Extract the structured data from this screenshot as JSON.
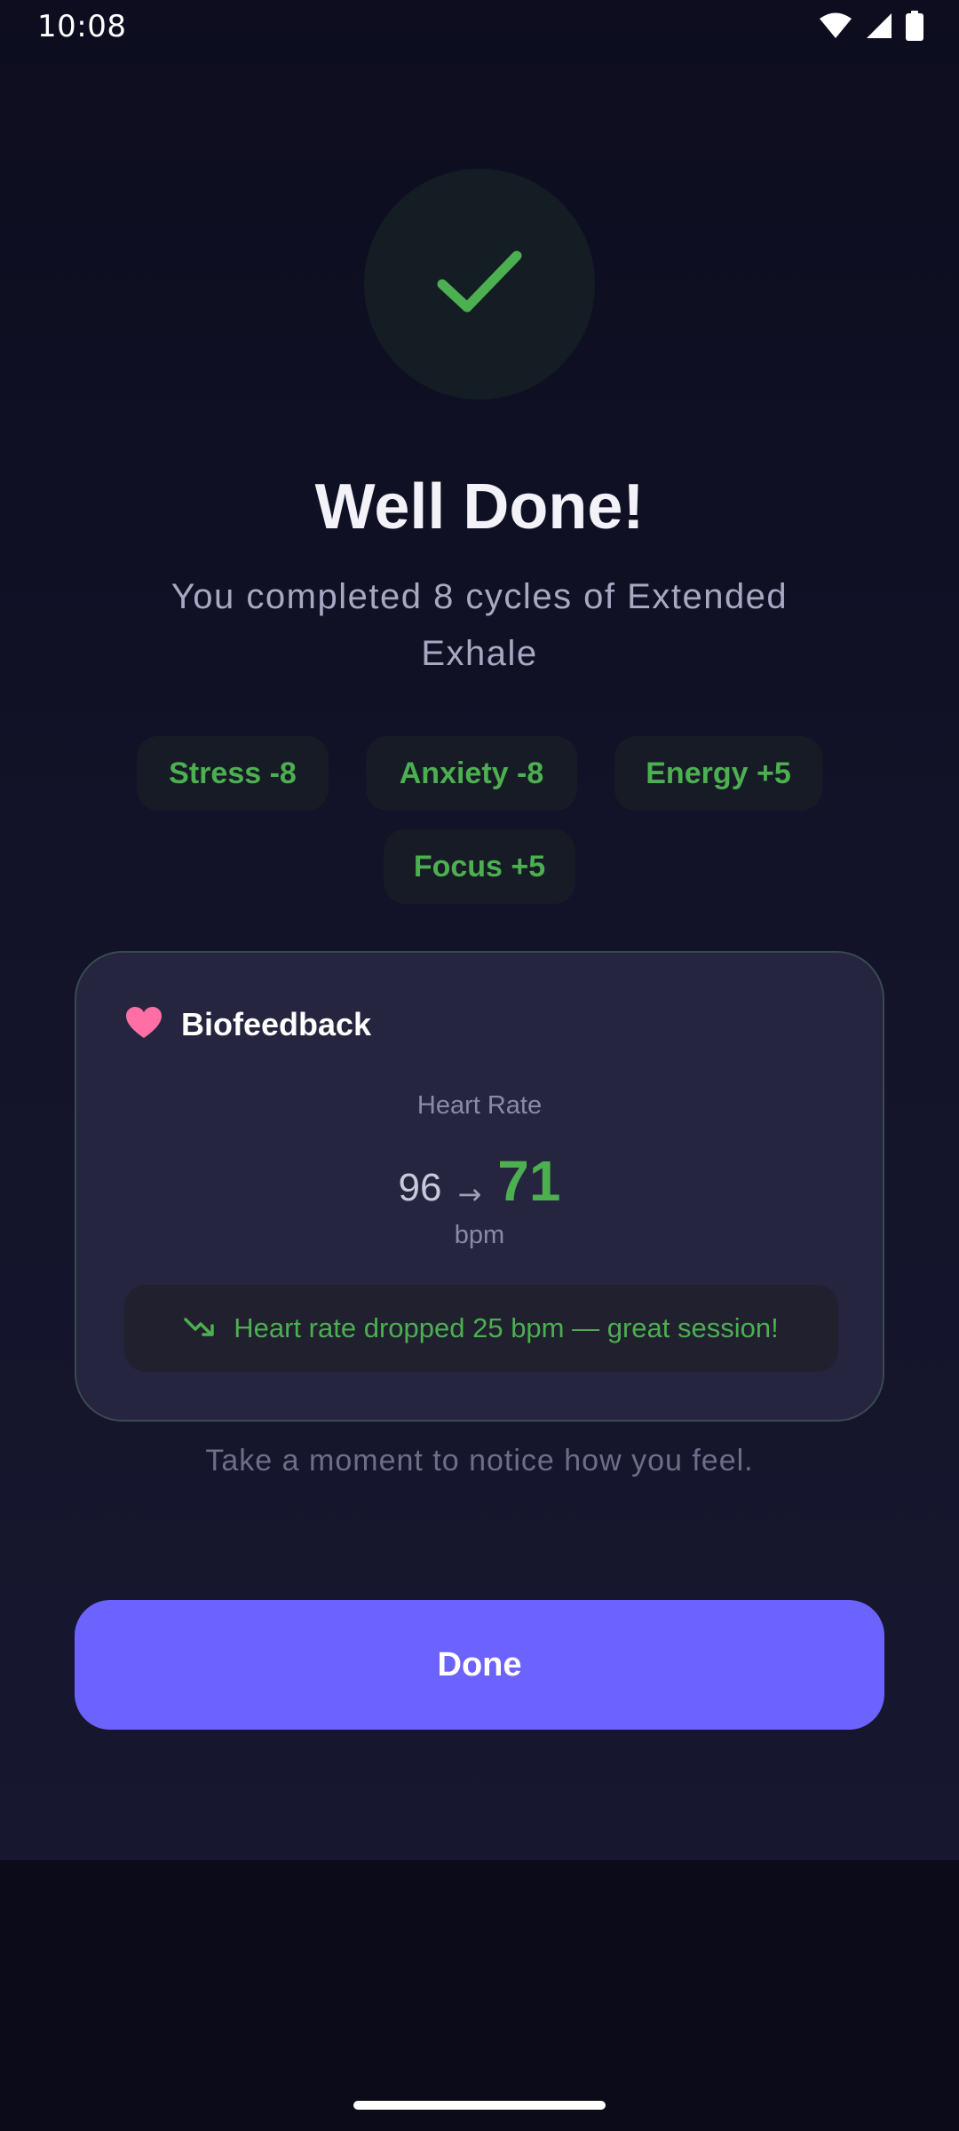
{
  "status_bar": {
    "time": "10:08",
    "icons": [
      "wifi-icon",
      "cell-signal-icon",
      "battery-icon"
    ]
  },
  "completion": {
    "icon": "checkmark-icon",
    "title": "Well Done!",
    "subtitle": "You completed 8 cycles of Extended Exhale"
  },
  "chips": [
    {
      "label": "Stress -8"
    },
    {
      "label": "Anxiety -8"
    },
    {
      "label": "Energy +5"
    },
    {
      "label": "Focus +5"
    }
  ],
  "biofeedback": {
    "icon": "heart-icon",
    "title": "Biofeedback",
    "metric_label": "Heart Rate",
    "before": "96",
    "arrow": "→",
    "after": "71",
    "unit": "bpm",
    "summary_icon": "trending-down-icon",
    "summary": "Heart rate dropped 25 bpm — great session!"
  },
  "hint": "Take a moment to notice how you feel.",
  "done_label": "Done",
  "colors": {
    "accent": "#6c63ff",
    "positive": "#4caf50",
    "heart": "#ff6fa5",
    "background": "#0d0d1f",
    "card": "#25253f"
  }
}
